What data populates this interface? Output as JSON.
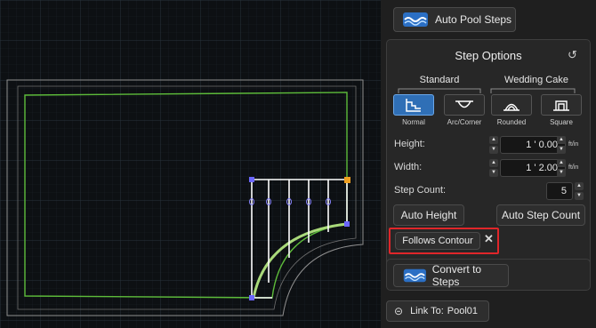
{
  "panel": {
    "auto_pool_steps_label": "Auto Pool Steps",
    "step_options_title": "Step Options",
    "standard_header": "Standard",
    "wedding_header": "Wedding Cake",
    "styles": [
      {
        "label": "Normal",
        "active": true
      },
      {
        "label": "Arc/Corner",
        "active": false
      },
      {
        "label": "Rounded",
        "active": false
      },
      {
        "label": "Square",
        "active": false
      }
    ],
    "height_label": "Height:",
    "height_value": "1 ' 0.00",
    "width_label": "Width:",
    "width_value": "1 ' 2.00",
    "unit_label": "ft/in",
    "step_count_label": "Step Count:",
    "step_count_value": "5",
    "auto_height_label": "Auto Height",
    "auto_step_count_label": "Auto Step Count",
    "follows_contour_label": "Follows Contour",
    "convert_label": "Convert to Steps",
    "link_label": "Link To:",
    "link_value": "Pool01"
  },
  "colors": {
    "canvas_bg": "#0d1013",
    "grid": "#1e262d",
    "pool_outline": "#9a9a9a",
    "green_outline": "#5dbb3a",
    "handle_blue": "#6b66ff",
    "handle_orange": "#f0a020",
    "highlight_red": "#e0262a",
    "active_style": "#2f6fb6"
  }
}
